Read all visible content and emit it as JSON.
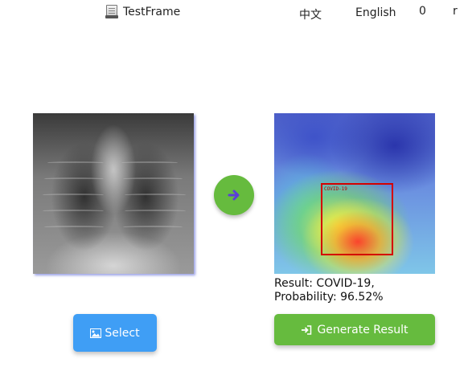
{
  "window": {
    "title": "TestFrame",
    "icon": "app-book-icon"
  },
  "language": {
    "zh": "中文",
    "en": "English"
  },
  "counter": "0",
  "edge_char": "r",
  "input_image": {
    "description_icon": "chest-xray-image"
  },
  "convert": {
    "icon": "arrow-right-icon",
    "color": "#66bb3e"
  },
  "output_image": {
    "bbox_label": "COVID-19"
  },
  "result": {
    "line1": "Result: COVID-19,",
    "line2": "Probability: 96.52%"
  },
  "buttons": {
    "select": {
      "label": "Select",
      "icon": "image-icon",
      "color": "#3f9ef5"
    },
    "generate": {
      "label": "Generate Result",
      "icon": "sign-in-icon",
      "color": "#66bb3e"
    }
  }
}
